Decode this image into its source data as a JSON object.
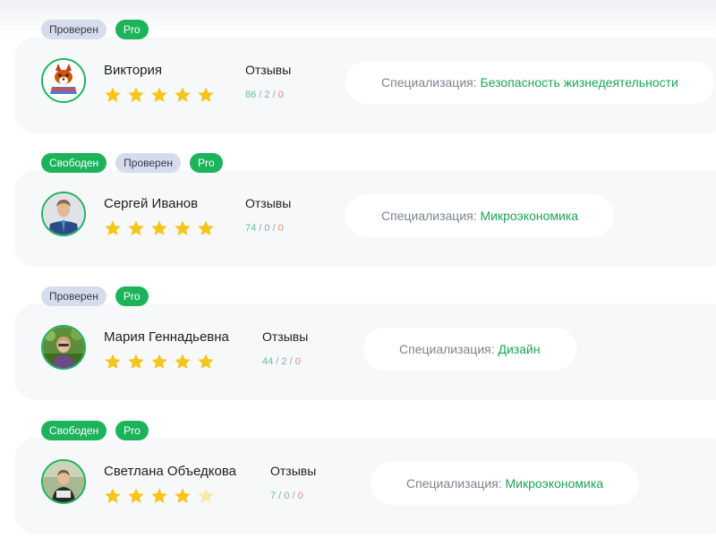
{
  "common": {
    "reviews_label": "Отзывы",
    "spec_label": "Специализация:",
    "sep": " / "
  },
  "colors": {
    "accent": "#1db35b",
    "verified_badge": "#d6dcec",
    "card_bg": "#f6f8fa",
    "star": "#f5c518",
    "count_positive": "#5cc392",
    "count_negative": "#ee8a6e"
  },
  "experts": [
    {
      "name": "Виктория",
      "badges": [
        "Проверен",
        "Pro"
      ],
      "rating": 5,
      "reviews": {
        "positive": "86",
        "neutral": "2",
        "negative": "0"
      },
      "specialization": "Безопасность жизнедеятельности",
      "avatar_icon": "fox-cartoon-avatar"
    },
    {
      "name": "Сергей Иванов",
      "badges": [
        "Свободен",
        "Проверен",
        "Pro"
      ],
      "rating": 5,
      "reviews": {
        "positive": "74",
        "neutral": "0",
        "negative": "0"
      },
      "specialization": "Микроэкономика",
      "avatar_icon": "person-photo-avatar"
    },
    {
      "name": "Мария Геннадьевна",
      "badges": [
        "Проверен",
        "Pro"
      ],
      "rating": 5,
      "reviews": {
        "positive": "44",
        "neutral": "2",
        "negative": "0"
      },
      "specialization": "Дизайн",
      "avatar_icon": "person-photo-avatar"
    },
    {
      "name": "Светлана Объедкова",
      "badges": [
        "Свободен",
        "Pro"
      ],
      "rating": 4,
      "reviews": {
        "positive": "7",
        "neutral": "0",
        "negative": "0"
      },
      "specialization": "Микроэкономика",
      "avatar_icon": "person-photo-avatar"
    }
  ]
}
